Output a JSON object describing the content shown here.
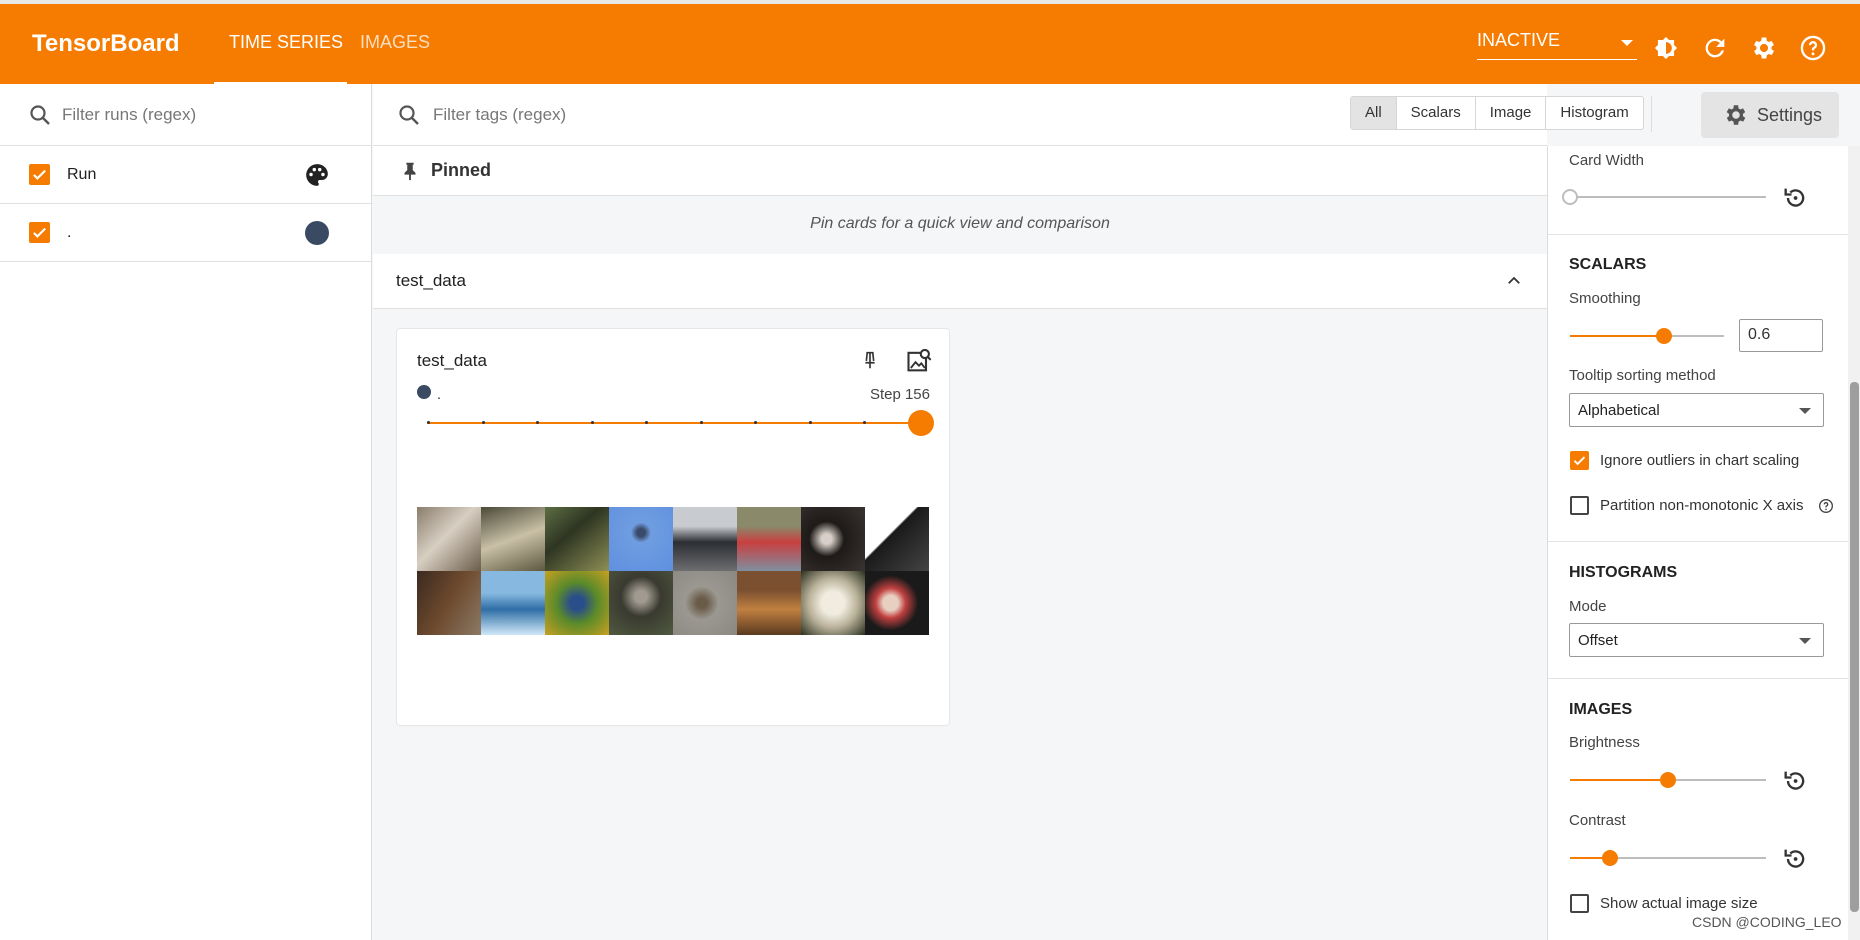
{
  "topbar": {
    "brand": "TensorBoard",
    "tabs": [
      {
        "label": "TIME SERIES"
      },
      {
        "label": "IMAGES"
      }
    ],
    "status_select": "INACTIVE",
    "accent": "#f57c00"
  },
  "runs": {
    "filter_placeholder": "Filter runs (regex)",
    "header_label": "Run",
    "items": [
      {
        "label": ".",
        "color": "#3b4a63"
      }
    ]
  },
  "main": {
    "tag_filter_placeholder": "Filter tags (regex)",
    "type_filters": [
      "All",
      "Scalars",
      "Image",
      "Histogram"
    ],
    "active_filter": "All",
    "settings_button": "Settings",
    "pinned_title": "Pinned",
    "pinned_hint": "Pin cards for a quick view and comparison",
    "group_title": "test_data",
    "card": {
      "title": "test_data",
      "run": ".",
      "step_label": "Step 156",
      "step_position": 1.0
    }
  },
  "settings": {
    "card_width_label": "Card Width",
    "card_width_value": 0,
    "scalars_title": "SCALARS",
    "smoothing_label": "Smoothing",
    "smoothing_value": "0.6",
    "tooltip_label": "Tooltip sorting method",
    "tooltip_value": "Alphabetical",
    "ignore_outliers_label": "Ignore outliers in chart scaling",
    "ignore_outliers": true,
    "partition_label": "Partition non-monotonic X axis",
    "partition": false,
    "histograms_title": "HISTOGRAMS",
    "mode_label": "Mode",
    "mode_value": "Offset",
    "images_title": "IMAGES",
    "brightness_label": "Brightness",
    "brightness_value": 0.5,
    "contrast_label": "Contrast",
    "contrast_value": 0.2,
    "actual_size_label": "Show actual image size",
    "actual_size": false
  },
  "watermark": "CSDN @CODING_LEO"
}
